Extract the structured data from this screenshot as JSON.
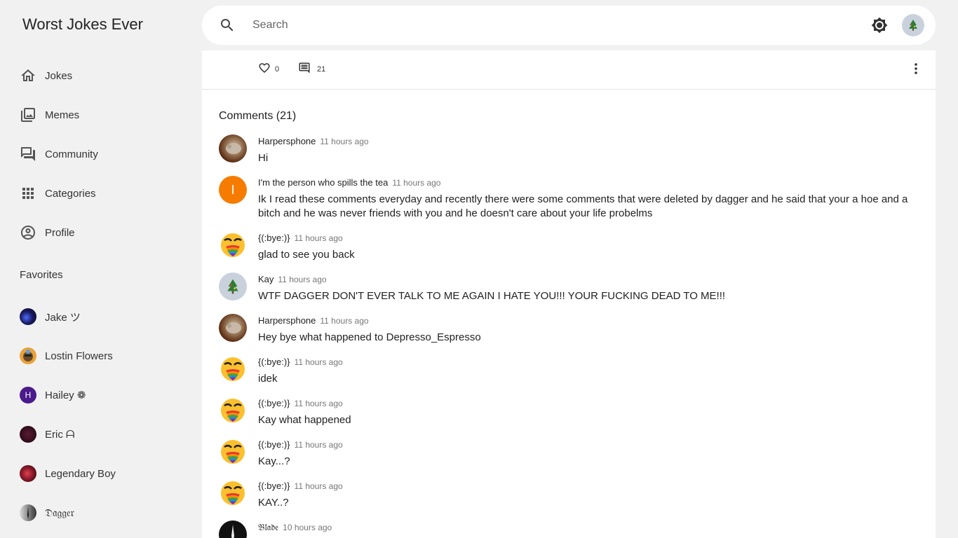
{
  "app": {
    "title": "Worst Jokes Ever"
  },
  "nav": [
    {
      "label": "Jokes",
      "icon": "home-icon"
    },
    {
      "label": "Memes",
      "icon": "photo-library-icon"
    },
    {
      "label": "Community",
      "icon": "forum-icon"
    },
    {
      "label": "Categories",
      "icon": "apps-grid-icon"
    },
    {
      "label": "Profile",
      "icon": "account-circle-icon"
    }
  ],
  "favorites": {
    "title": "Favorites",
    "items": [
      {
        "label": "Jake ツ",
        "avatar_color": "#1a1a5e"
      },
      {
        "label": "Lostin Flowers",
        "avatar_color": "#d98b2a"
      },
      {
        "label": "Hailey ❁",
        "avatar_letter": "H",
        "avatar_color": "#4a1a8c"
      },
      {
        "label": "Eric ᗩ",
        "avatar_color": "#2a0a1a"
      },
      {
        "label": "Legendary Boy",
        "avatar_color": "#8c1a2a"
      },
      {
        "label": "𝔇𝔞𝔤𝔤𝔢𝔯",
        "avatar_color": "#555555"
      }
    ]
  },
  "search": {
    "placeholder": "Search"
  },
  "post_actions": {
    "likes": "0",
    "comments": "21"
  },
  "comments": {
    "title": "Comments (21)",
    "items": [
      {
        "author": "Harpersphone",
        "time": "11 hours ago",
        "text": "Hi",
        "avatar": "photo-brown"
      },
      {
        "author": "I'm the person who spills the tea",
        "time": "11 hours ago",
        "text": "Ik I read these comments everyday and recently there were some comments that were deleted by dagger and he said that your a hoe and a bitch and he was never friends with you and he doesn't care about your life probelms",
        "avatar": "letter",
        "avatar_letter": "I",
        "avatar_color": "#f57c00"
      },
      {
        "author": "{(:bye:)}",
        "time": "11 hours ago",
        "text": "glad to see you back",
        "avatar": "emoji-heart"
      },
      {
        "author": "Kay",
        "time": "11 hours ago",
        "text": "WTF DAGGER DON'T EVER TALK TO ME AGAIN I HATE YOU!!! YOUR FUCKING DEAD TO ME!!!",
        "avatar": "tree"
      },
      {
        "author": "Harpersphone",
        "time": "11 hours ago",
        "text": "Hey bye what happened to Depresso_Espresso",
        "avatar": "photo-brown"
      },
      {
        "author": "{(:bye:)}",
        "time": "11 hours ago",
        "text": "idek",
        "avatar": "emoji-heart"
      },
      {
        "author": "{(:bye:)}",
        "time": "11 hours ago",
        "text": "Kay what happened",
        "avatar": "emoji-heart"
      },
      {
        "author": "{(:bye:)}",
        "time": "11 hours ago",
        "text": "Kay...?",
        "avatar": "emoji-heart"
      },
      {
        "author": "{(:bye:)}",
        "time": "11 hours ago",
        "text": "KAY..?",
        "avatar": "emoji-heart"
      },
      {
        "author": "𝔅𝔩𝔞𝔡𝔢",
        "time": "10 hours ago",
        "text": "",
        "avatar": "dark"
      }
    ]
  }
}
